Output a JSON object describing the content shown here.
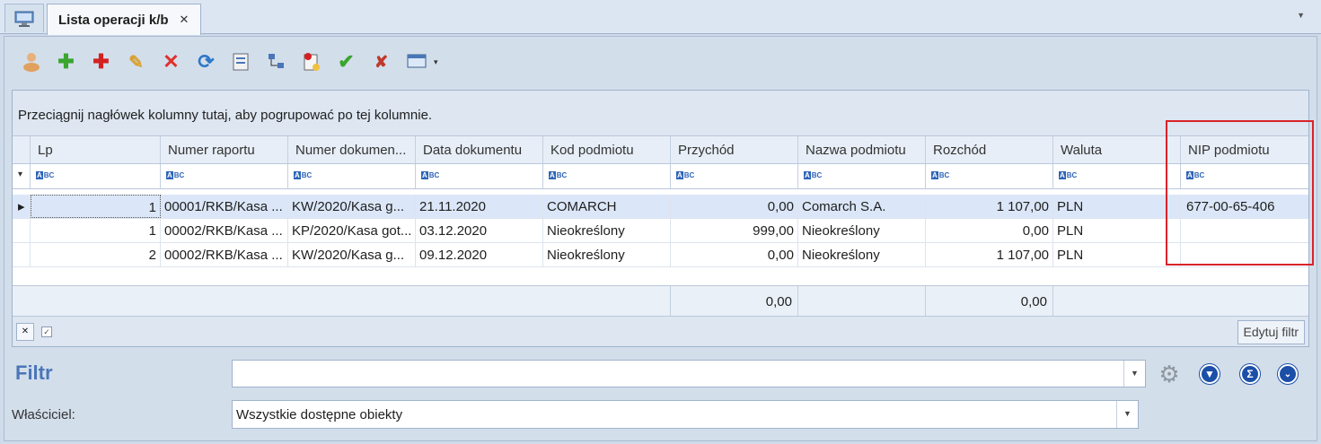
{
  "tab": {
    "title": "Lista operacji k/b",
    "close": "✕"
  },
  "toolbar": {
    "icons": [
      "person-icon",
      "add-icon",
      "add-red-icon",
      "wrench-icon",
      "delete-icon",
      "refresh-icon",
      "export-icon",
      "structure-icon",
      "document-icon",
      "approve-icon",
      "cancel-approve-icon",
      "screen-icon"
    ],
    "dropdown": "▾"
  },
  "grid": {
    "group_hint": "Przeciągnij nagłówek kolumny tutaj, aby pogrupować po tej kolumnie.",
    "columns": [
      "Lp",
      "Numer raportu",
      "Numer dokumen...",
      "Data dokumentu",
      "Kod podmiotu",
      "Przychód",
      "Nazwa podmiotu",
      "Rozchód",
      "Waluta",
      "NIP podmiotu"
    ],
    "rows": [
      {
        "lp": "1",
        "report": "00001/RKB/Kasa ...",
        "doc": "KW/2020/Kasa g...",
        "date": "21.11.2020",
        "code": "COMARCH",
        "income": "0,00",
        "name": "Comarch S.A.",
        "expense": "1 107,00",
        "currency": "PLN",
        "nip": "677-00-65-406"
      },
      {
        "lp": "1",
        "report": "00002/RKB/Kasa ...",
        "doc": "KP/2020/Kasa got...",
        "date": "03.12.2020",
        "code": "Nieokreślony",
        "income": "999,00",
        "name": "Nieokreślony",
        "expense": "0,00",
        "currency": "PLN",
        "nip": ""
      },
      {
        "lp": "2",
        "report": "00002/RKB/Kasa ...",
        "doc": "KW/2020/Kasa g...",
        "date": "09.12.2020",
        "code": "Nieokreślony",
        "income": "0,00",
        "name": "Nieokreślony",
        "expense": "1 107,00",
        "currency": "PLN",
        "nip": ""
      }
    ],
    "totals": {
      "income": "0,00",
      "expense": "0,00"
    },
    "edit_filter": "Edytuj filtr"
  },
  "filter": {
    "label": "Filtr",
    "value": ""
  },
  "owner": {
    "label": "Właściciel:",
    "value": "Wszystkie dostępne obiekty"
  },
  "colors": {
    "accent": "#4a76b8",
    "highlight": "#d9232a",
    "selected_row": "#dbe7f8"
  }
}
